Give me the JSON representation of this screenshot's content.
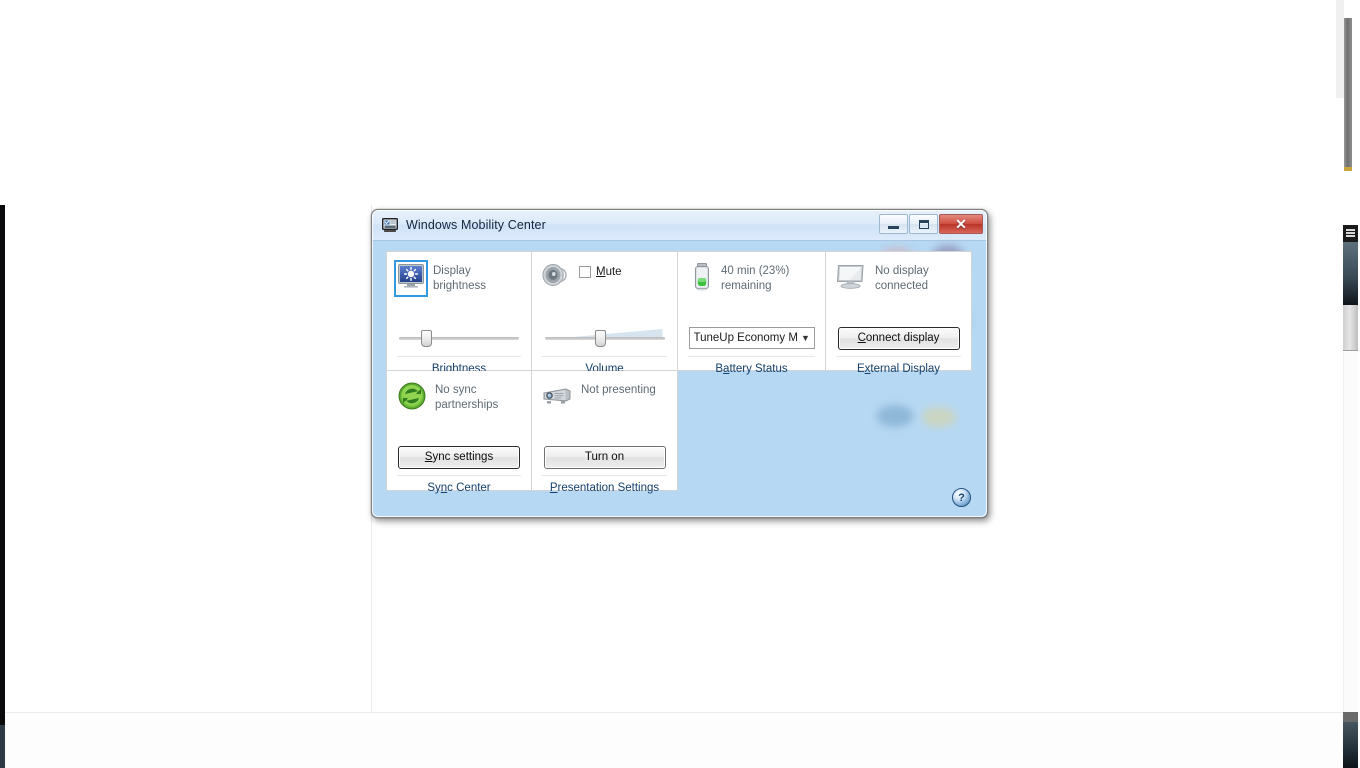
{
  "window": {
    "title": "Windows Mobility Center",
    "icon": "mobility-center-icon",
    "controls": {
      "minimize": "–",
      "maximize": "□",
      "close": "✕"
    }
  },
  "tiles": {
    "brightness": {
      "icon": "brightness-icon",
      "caption": "Display brightness",
      "footer_label": "Brightness",
      "footer_accesskey": "B",
      "slider_value": 18
    },
    "volume": {
      "icon": "speaker-icon",
      "mute_label": "Mute",
      "mute_accesskey": "M",
      "mute_checked": false,
      "footer_label": "Volume",
      "footer_accesskey": "V",
      "slider_value": 42
    },
    "battery": {
      "icon": "battery-icon",
      "caption": "40 min (23%) remaining",
      "plan_selected": "TuneUp Economy Mode",
      "plan_display": "TuneUp Economy M",
      "footer_label": "Battery Status",
      "footer_accesskey": "a"
    },
    "external_display": {
      "icon": "monitor-icon",
      "caption": "No display connected",
      "button_label": "Connect display",
      "button_accesskey": "C",
      "footer_label": "External Display",
      "footer_accesskey": "x"
    },
    "sync": {
      "icon": "sync-icon",
      "caption": "No sync partnerships",
      "button_label": "Sync settings",
      "button_accesskey": "S",
      "footer_label": "Sync Center",
      "footer_accesskey": "n"
    },
    "presentation": {
      "icon": "projector-icon",
      "caption": "Not presenting",
      "button_label": "Turn on",
      "footer_label": "Presentation Settings",
      "footer_accesskey": "P"
    }
  },
  "help": {
    "icon": "help-icon",
    "glyph": "?"
  },
  "colors": {
    "window_body": "#b6d8f2",
    "titlebar": "#dceafa",
    "close_button": "#c0392b",
    "tile_background": "#ffffff",
    "caption_text": "#5f6b74",
    "link_text": "#13406e",
    "focus_outline": "#3399dd"
  }
}
